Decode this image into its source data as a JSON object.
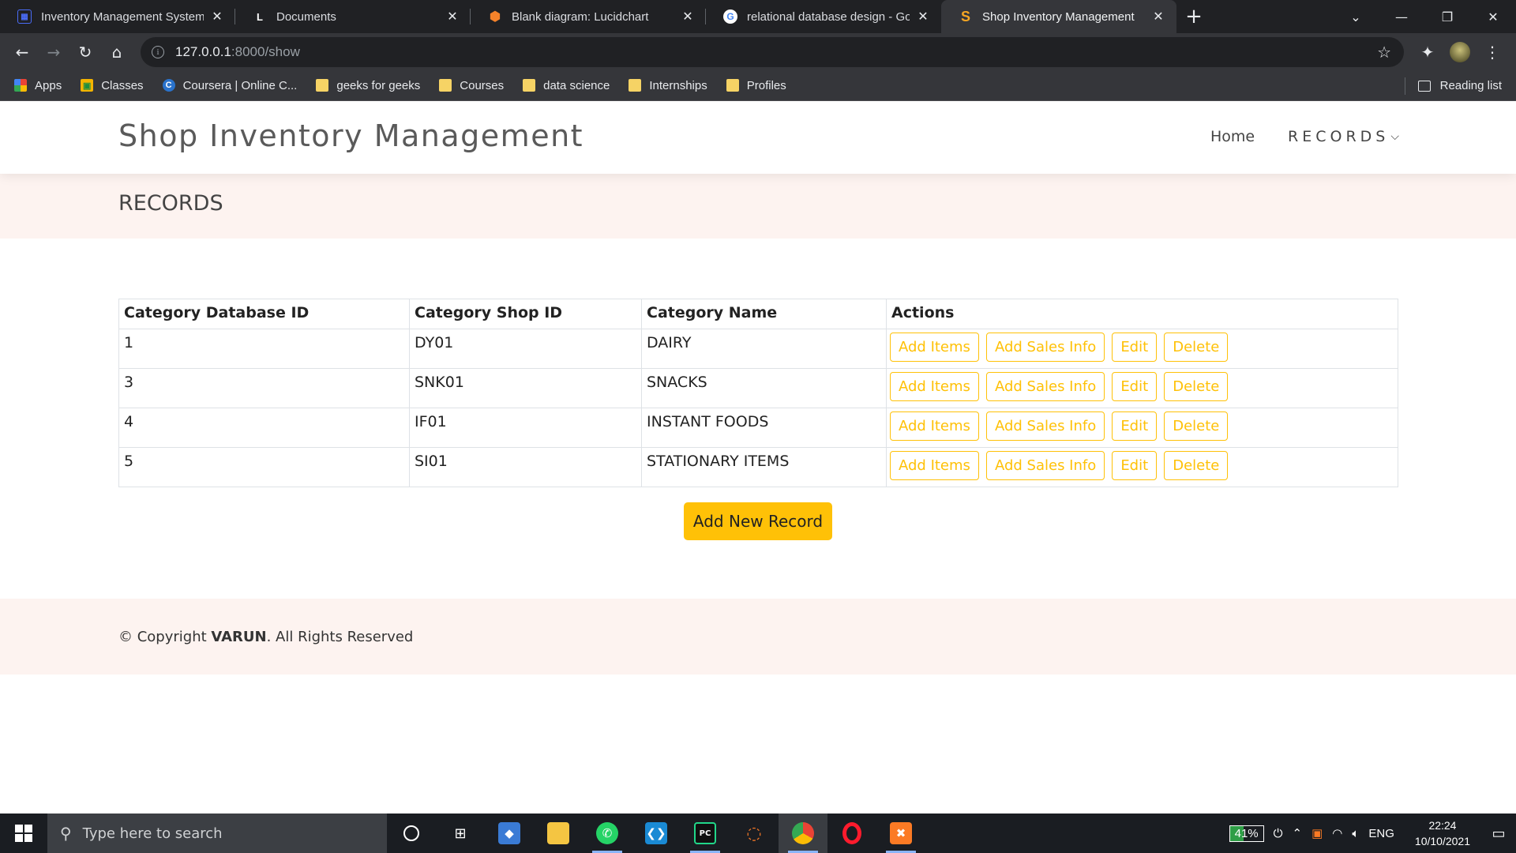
{
  "browser": {
    "tabs": [
      {
        "title": "Inventory Management System P",
        "favicon": "project-icon",
        "favicon_color": "#4a6cf7",
        "active": false
      },
      {
        "title": "Documents",
        "favicon": "document-icon",
        "favicon_color": "#ffffff",
        "active": false
      },
      {
        "title": "Blank diagram: Lucidchart",
        "favicon": "lucidchart-icon",
        "favicon_color": "#f5822a",
        "active": false
      },
      {
        "title": "relational database design - Goo",
        "favicon": "google-icon",
        "favicon_color": "#4285f4",
        "active": false
      },
      {
        "title": "Shop Inventory Management",
        "favicon": "s-icon",
        "favicon_color": "#f5a623",
        "active": true
      }
    ],
    "address": {
      "host": "127.0.0.1",
      "path": ":8000/show"
    },
    "bookmarks": [
      {
        "label": "Apps",
        "icon": "apps-grid-icon"
      },
      {
        "label": "Classes",
        "icon": "classroom-icon"
      },
      {
        "label": "Coursera | Online C...",
        "icon": "coursera-icon"
      },
      {
        "label": "geeks for geeks",
        "icon": "folder-icon"
      },
      {
        "label": "Courses",
        "icon": "folder-icon"
      },
      {
        "label": "data science",
        "icon": "folder-icon"
      },
      {
        "label": "Internships",
        "icon": "folder-icon"
      },
      {
        "label": "Profiles",
        "icon": "folder-icon"
      }
    ],
    "reading_list": "Reading list"
  },
  "site": {
    "title": "Shop Inventory Management",
    "nav": {
      "home": "Home",
      "records": "RECORDS"
    },
    "section_title": "RECORDS",
    "accent_color": "#ffc107"
  },
  "table": {
    "headers": [
      "Category Database ID",
      "Category Shop ID",
      "Category Name",
      "Actions"
    ],
    "rows": [
      {
        "db_id": "1",
        "shop_id": "DY01",
        "name": "DAIRY"
      },
      {
        "db_id": "3",
        "shop_id": "SNK01",
        "name": "SNACKS"
      },
      {
        "db_id": "4",
        "shop_id": "IF01",
        "name": "INSTANT FOODS"
      },
      {
        "db_id": "5",
        "shop_id": "SI01",
        "name": "STATIONARY ITEMS"
      }
    ],
    "action_labels": {
      "add_items": "Add Items",
      "add_sales": "Add Sales Info",
      "edit": "Edit",
      "delete": "Delete"
    }
  },
  "add_new_record": "Add New Record",
  "footer": {
    "prefix": "© Copyright ",
    "owner": "VARUN",
    "suffix": ". All Rights Reserved"
  },
  "taskbar": {
    "search_placeholder": "Type here to search",
    "battery": "41%",
    "language": "ENG",
    "time": "22:24",
    "date": "10/10/2021"
  }
}
